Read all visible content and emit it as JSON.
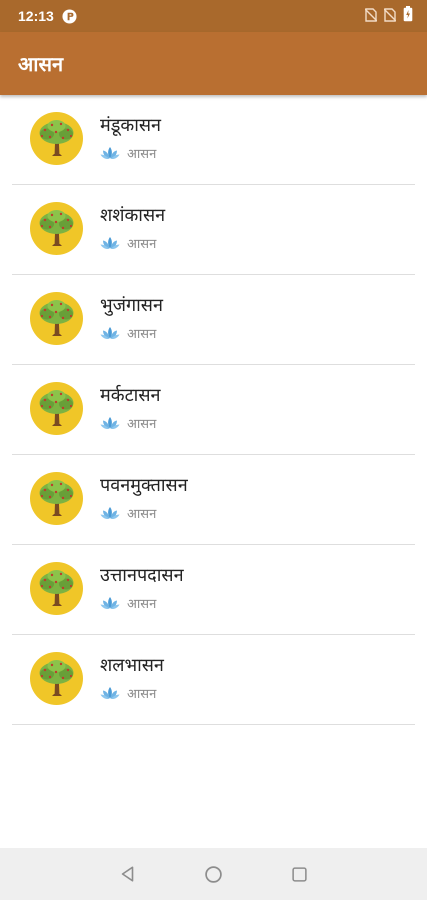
{
  "status_bar": {
    "time": "12:13",
    "icons": [
      "notification-icon",
      "no-sim-icon",
      "no-sim-icon",
      "battery-icon"
    ]
  },
  "app_bar": {
    "title": "आसन"
  },
  "colors": {
    "status_bar": "#a9692c",
    "app_bar": "#b96f31",
    "avatar_bg": "#f0c628",
    "lotus": "#4a9bd6",
    "nav_bar": "#efefef"
  },
  "items": [
    {
      "title": "मंडूकासन",
      "subtitle": "आसन",
      "icon": "tree-icon",
      "sub_icon": "lotus-icon"
    },
    {
      "title": "शशंकासन",
      "subtitle": "आसन",
      "icon": "tree-icon",
      "sub_icon": "lotus-icon"
    },
    {
      "title": "भुजंगासन",
      "subtitle": "आसन",
      "icon": "tree-icon",
      "sub_icon": "lotus-icon"
    },
    {
      "title": "मर्कटासन",
      "subtitle": "आसन",
      "icon": "tree-icon",
      "sub_icon": "lotus-icon"
    },
    {
      "title": "पवनमुक्तासन",
      "subtitle": "आसन",
      "icon": "tree-icon",
      "sub_icon": "lotus-icon"
    },
    {
      "title": "उत्तानपदासन",
      "subtitle": "आसन",
      "icon": "tree-icon",
      "sub_icon": "lotus-icon"
    },
    {
      "title": "शलभासन",
      "subtitle": "आसन",
      "icon": "tree-icon",
      "sub_icon": "lotus-icon"
    }
  ],
  "nav_bar": {
    "buttons": [
      "back-icon",
      "home-icon",
      "recents-icon"
    ]
  }
}
